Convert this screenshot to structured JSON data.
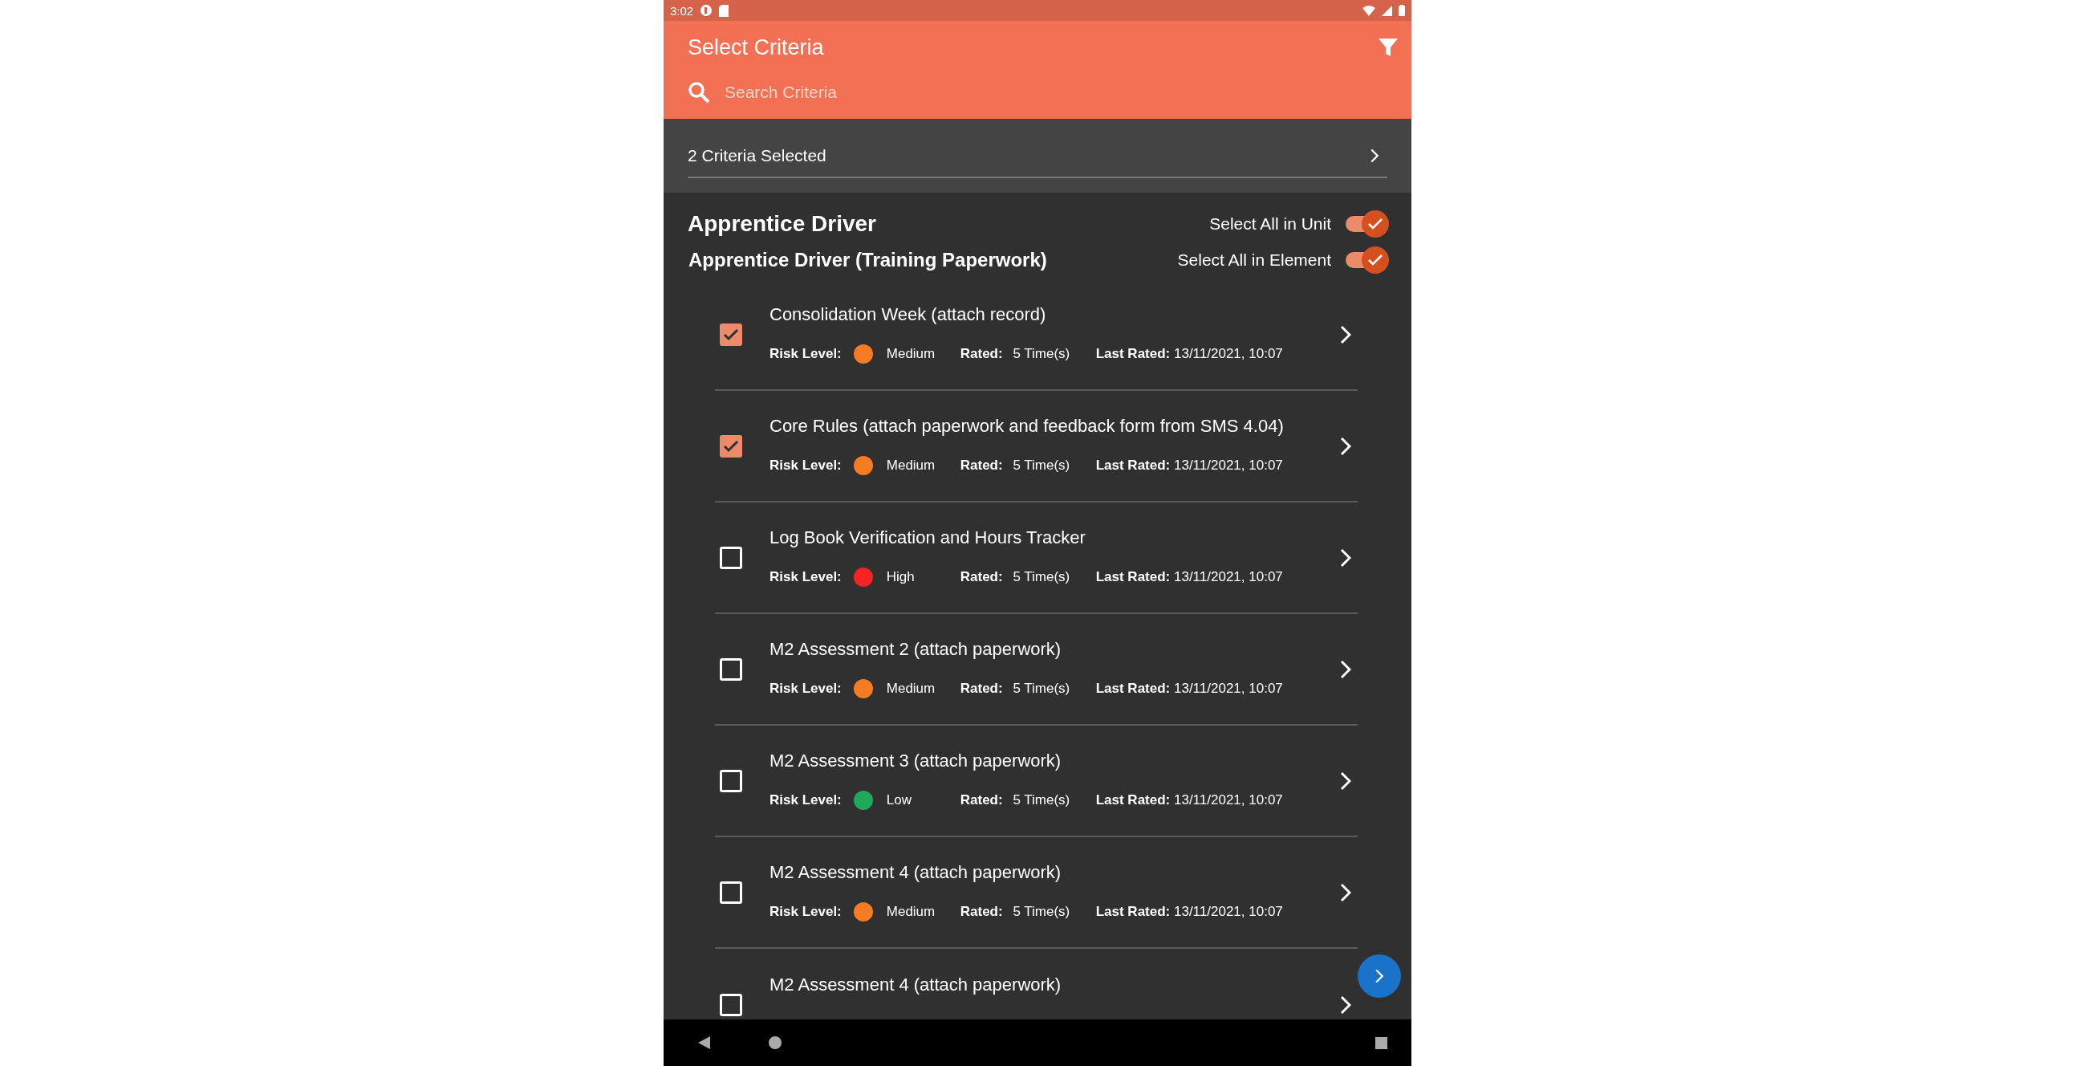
{
  "status_bar": {
    "time": "3:02"
  },
  "app_bar": {
    "title": "Select Criteria",
    "search": {
      "placeholder": "Search Criteria"
    }
  },
  "selection_summary": {
    "label": "2 Criteria Selected"
  },
  "unit": {
    "title": "Apprentice Driver",
    "toggle": {
      "label": "Select All in Unit",
      "on": true
    }
  },
  "element": {
    "title": "Apprentice Driver (Training Paperwork)",
    "toggle": {
      "label": "Select All in Element",
      "on": true
    }
  },
  "criteria": [
    {
      "title": "Consolidation Week (attach record)",
      "checked": true,
      "risk_label": "Risk Level:",
      "risk": "Medium",
      "color": "#f57c22",
      "rated_label": "Rated:",
      "rated": "5 Time(s)",
      "last_rated_label": "Last Rated:",
      "last_rated": "13/11/2021, 10:07"
    },
    {
      "title": "Core Rules (attach paperwork and feedback form from SMS 4.04)",
      "checked": true,
      "risk_label": "Risk Level:",
      "risk": "Medium",
      "color": "#f57c22",
      "rated_label": "Rated:",
      "rated": "5 Time(s)",
      "last_rated_label": "Last Rated:",
      "last_rated": "13/11/2021, 10:07"
    },
    {
      "title": "Log Book Verification and Hours Tracker",
      "checked": false,
      "risk_label": "Risk Level:",
      "risk": "High",
      "color": "#f52323",
      "rated_label": "Rated:",
      "rated": "5 Time(s)",
      "last_rated_label": "Last Rated:",
      "last_rated": "13/11/2021, 10:07"
    },
    {
      "title": "M2 Assessment 2 (attach paperwork)",
      "checked": false,
      "risk_label": "Risk Level:",
      "risk": "Medium",
      "color": "#f57c22",
      "rated_label": "Rated:",
      "rated": "5 Time(s)",
      "last_rated_label": "Last Rated:",
      "last_rated": "13/11/2021, 10:07"
    },
    {
      "title": "M2 Assessment 3 (attach paperwork)",
      "checked": false,
      "risk_label": "Risk Level:",
      "risk": "Low",
      "color": "#1fa95a",
      "rated_label": "Rated:",
      "rated": "5 Time(s)",
      "last_rated_label": "Last Rated:",
      "last_rated": "13/11/2021, 10:07"
    },
    {
      "title": "M2 Assessment 4 (attach paperwork)",
      "checked": false,
      "risk_label": "Risk Level:",
      "risk": "Medium",
      "color": "#f57c22",
      "rated_label": "Rated:",
      "rated": "5 Time(s)",
      "last_rated_label": "Last Rated:",
      "last_rated": "13/11/2021, 10:07"
    },
    {
      "title": "M2 Assessment 4 (attach paperwork)",
      "checked": false
    }
  ]
}
